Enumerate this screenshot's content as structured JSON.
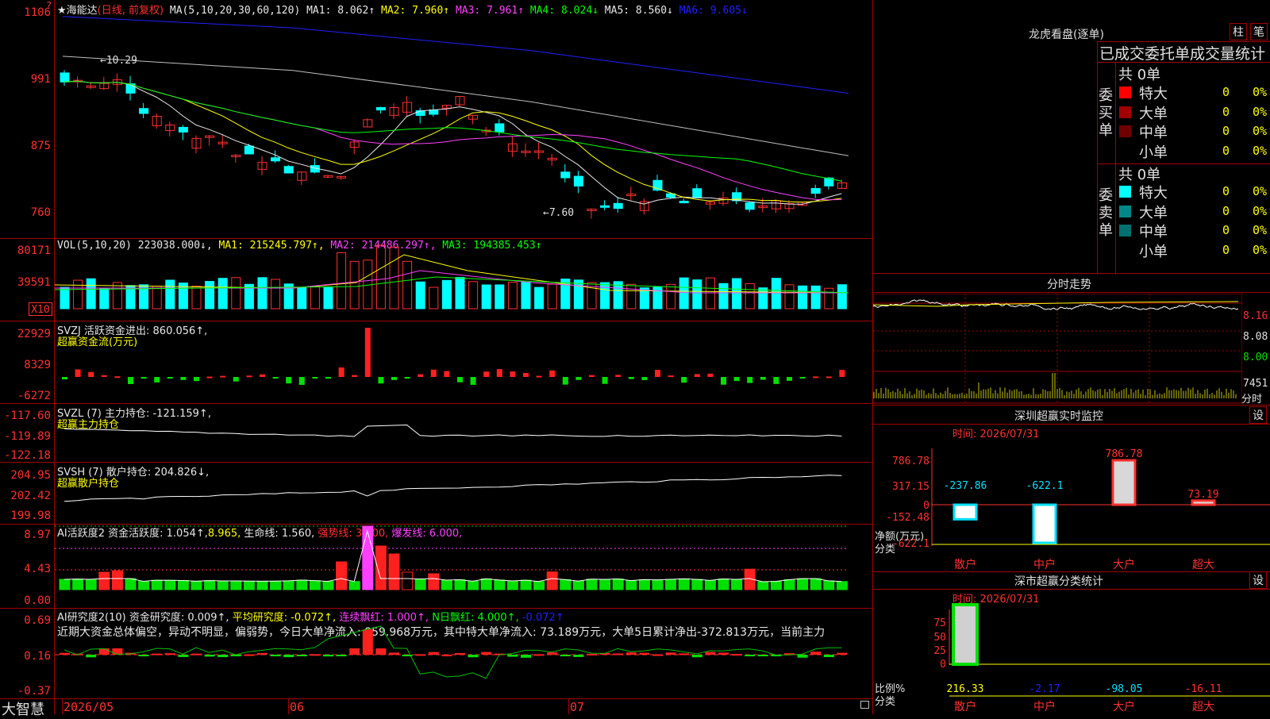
{
  "header": {
    "stock": "★海能达",
    "period": "(日线, 前复权)",
    "ma_label": "MA(5,10,20,30,60,120)",
    "ma": [
      {
        "text": "MA1: 8.062↑",
        "color": "#e8e8e8"
      },
      {
        "text": "MA2: 7.960↑",
        "color": "#ffff00"
      },
      {
        "text": "MA3: 7.961↑",
        "color": "#ff40ff"
      },
      {
        "text": "MA4: 8.024↓",
        "color": "#00ff00"
      },
      {
        "text": "MA5: 8.560↓",
        "color": "#e8e8e8"
      },
      {
        "text": "MA6: 9.605↓",
        "color": "#2020ff"
      }
    ],
    "question": "?"
  },
  "price_axis": [
    "1106",
    "991",
    "875",
    "760"
  ],
  "price_notes": {
    "high": "←10.29",
    "low": "←7.60"
  },
  "vol": {
    "label": "VOL(5,10,20)",
    "value": "223038.000↓,",
    "ma1": "MA1: 215245.797↑,",
    "ma2": "MA2: 214486.297↑,",
    "ma3": "MA3: 194385.453↑",
    "axis": [
      "80171",
      "39591"
    ],
    "unit": "X10"
  },
  "svzj": {
    "l1": "SVZJ  活跃资金进出: 860.056↑,",
    "l2": "超赢资金流(万元)",
    "axis": [
      "22929",
      "8329",
      "-6272"
    ]
  },
  "svzl": {
    "l1": "SVZL (7) 主力持仓: -121.159↑,",
    "l2": "超赢主力持仓",
    "axis": [
      "-117.60",
      "-119.89",
      "-122.18"
    ]
  },
  "svsh": {
    "l1": "SVSH (7) 散户持仓: 204.826↓,",
    "l2": "超赢散户持仓",
    "axis": [
      "204.95",
      "202.42",
      "199.98"
    ]
  },
  "ai1": {
    "l1a": "AI活跃度2 资金活跃度: 1.054↑,",
    "l1b": "8.965,",
    "l1c": "生命线: 1.560,",
    "l1d": "强势线: 3.000,",
    "l1e": "爆发线: 6.000,",
    "axis": [
      "8.97",
      "4.43",
      "0.00"
    ]
  },
  "ai2": {
    "l1a": "AI研究度2(10) 资金研究度: 0.009↑,",
    "l1b": "平均研究度: -0.072↑,",
    "l1c": "连续飘红: 1.000↑,",
    "l1d": "N日飘红: 4.000↑,",
    "l1e": "-0.072↑",
    "desc": "近期大资金总体偏空，异动不明显，偏弱势，今日大单净流入: 859.968万元，其中特大单净流入: 73.189万元，大单5日累计净出-372.813万元，当前主力",
    "axis": [
      "0.69",
      "0.16",
      "-0.37"
    ]
  },
  "footer": {
    "brand": "大智慧",
    "dates": [
      "2026/05",
      "06",
      "07"
    ]
  },
  "longhu": {
    "title": "龙虎看盘(逐单)",
    "btn1": "柱",
    "btn2": "笔",
    "header": "已成交委托单成交量统计",
    "buy_side": "委买单",
    "sell_side": "委卖单",
    "buy_total": "共 0单",
    "sell_total": "共 0单",
    "buy_rows": [
      {
        "name": "特大",
        "color": "#ff0000",
        "qty": "0",
        "pct": "0%"
      },
      {
        "name": "大单",
        "color": "#a00000",
        "qty": "0",
        "pct": "0%"
      },
      {
        "name": "中单",
        "color": "#700000",
        "qty": "0",
        "pct": "0%"
      },
      {
        "name": "小单",
        "color": "",
        "qty": "0",
        "pct": "0%"
      }
    ],
    "sell_rows": [
      {
        "name": "特大",
        "color": "#00ffff",
        "qty": "0",
        "pct": "0%"
      },
      {
        "name": "大单",
        "color": "#008888",
        "qty": "0",
        "pct": "0%"
      },
      {
        "name": "中单",
        "color": "#007070",
        "qty": "0",
        "pct": "0%"
      },
      {
        "name": "小单",
        "color": "",
        "qty": "0",
        "pct": "0%"
      }
    ]
  },
  "fenshi": {
    "title": "分时走势",
    "axis": [
      "8.16",
      "8.08",
      "8.00"
    ],
    "vol": "7451",
    "unit": "分时"
  },
  "sz_monitor": {
    "title": "深圳超赢实时监控",
    "btn": "设",
    "time": "时间: 2026/07/31",
    "axis": [
      "786.78",
      "317.15",
      "0",
      "-152.48",
      "-622.1"
    ],
    "ylabel": "净额(万元)",
    "xlabel": "分类",
    "cats": [
      "散户",
      "中户",
      "大户",
      "超大"
    ],
    "values": [
      -237.86,
      -622.1,
      786.78,
      73.19
    ],
    "value_labels": [
      "-237.86",
      "-622.1",
      "786.78",
      "73.19"
    ]
  },
  "sz_class": {
    "title": "深市超赢分类统计",
    "btn": "设",
    "time": "时间: 2026/07/31",
    "axis": [
      "75",
      "50",
      "25",
      "0"
    ],
    "ylabel": "比例%",
    "xlabel": "分类",
    "cats": [
      "散户",
      "中户",
      "大户",
      "超大"
    ],
    "values": [
      "216.33",
      "-2.17",
      "-98.05",
      "-16.11"
    ]
  }
}
